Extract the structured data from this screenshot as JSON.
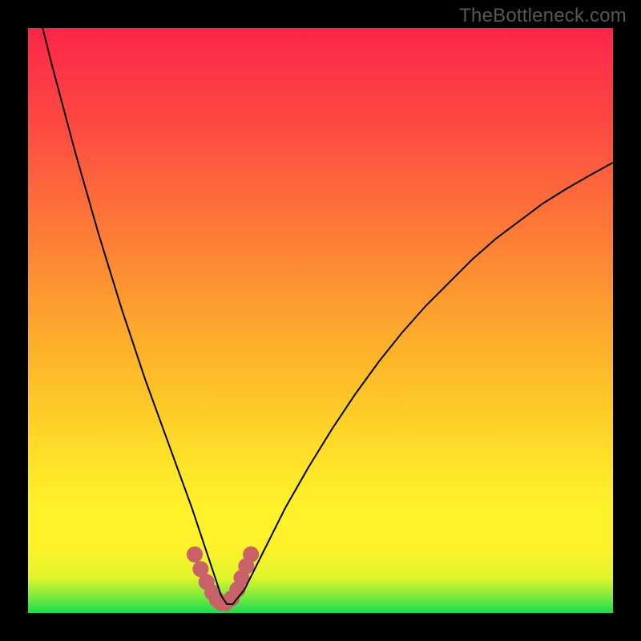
{
  "watermark": "TheBottleneck.com",
  "colors": {
    "frame": "#000000",
    "curve": "#000000",
    "marker": "#c96168",
    "green": "#18dc4f",
    "yellow": "#fff12a",
    "orange": "#fdab28",
    "red": "#fd2548",
    "darkred": "#fd2548"
  },
  "chart_data": {
    "type": "line",
    "title": "",
    "xlabel": "",
    "ylabel": "",
    "xlim": [
      0,
      100
    ],
    "ylim": [
      0,
      100
    ],
    "grid": false,
    "series": [
      {
        "name": "bottleneck-curve",
        "x": [
          0,
          2,
          4,
          6,
          8,
          10,
          12,
          14,
          16,
          18,
          20,
          22,
          24,
          26,
          28,
          30,
          32,
          33,
          34,
          35,
          37,
          40,
          44,
          48,
          52,
          56,
          60,
          64,
          68,
          72,
          76,
          80,
          84,
          88,
          92,
          96,
          100
        ],
        "y": [
          110,
          102,
          94,
          86.5,
          79,
          72,
          65,
          58.5,
          52,
          46,
          40,
          34.5,
          29,
          23.5,
          18,
          12,
          6,
          3,
          1.5,
          1.5,
          4,
          10,
          18,
          25,
          31.5,
          37.5,
          43,
          48,
          52.5,
          56.5,
          60.5,
          64,
          67,
          70,
          72.5,
          74.8,
          77
        ]
      }
    ],
    "markers": {
      "name": "highlight-band",
      "x": [
        28.5,
        29.5,
        30.5,
        31.5,
        32.3,
        33.0,
        33.8,
        34.8,
        35.8,
        36.5,
        37.3,
        38.1
      ],
      "y": [
        10.0,
        7.5,
        5.3,
        3.5,
        2.3,
        1.7,
        1.7,
        2.5,
        4.0,
        6.0,
        8.0,
        10.0
      ]
    },
    "background_gradient": {
      "stops": [
        {
          "pos": 0.0,
          "color": "#18dc4f"
        },
        {
          "pos": 0.028,
          "color": "#7de93d"
        },
        {
          "pos": 0.06,
          "color": "#e0f52c"
        },
        {
          "pos": 0.11,
          "color": "#fff22a"
        },
        {
          "pos": 0.18,
          "color": "#fff12a"
        },
        {
          "pos": 0.26,
          "color": "#fee229"
        },
        {
          "pos": 0.38,
          "color": "#fdc328"
        },
        {
          "pos": 0.52,
          "color": "#fd9f2f"
        },
        {
          "pos": 0.68,
          "color": "#fd7339"
        },
        {
          "pos": 0.83,
          "color": "#fd4b42"
        },
        {
          "pos": 1.0,
          "color": "#fd2548"
        }
      ]
    }
  }
}
